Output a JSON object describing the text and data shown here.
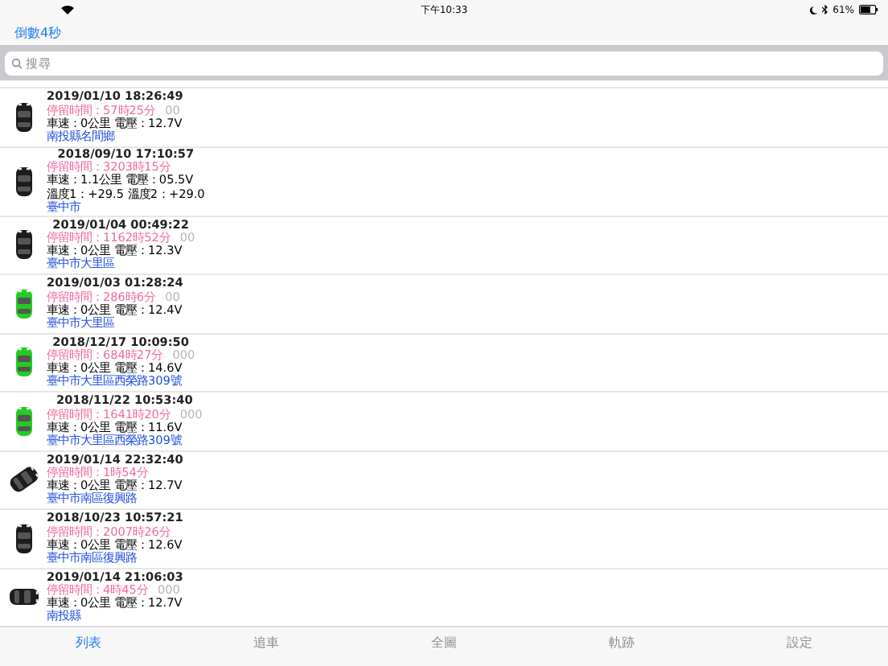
{
  "status_bar": {
    "time": "下午10:33",
    "battery": "61%"
  },
  "nav": {
    "countdown": "倒數4秒"
  },
  "search": {
    "placeholder": "搜尋"
  },
  "rows": [
    {
      "time": "2019/01/10 18:26:49",
      "stay": "停留時間：57時25分",
      "code": "00",
      "stats": "車速：0公里 電壓：12.7V",
      "address": "南投縣名間鄉",
      "kind": "upright",
      "color": "#1c1c1c"
    },
    {
      "time": "2018/09/10 17:10:57",
      "stay": "停留時間：3203時15分",
      "stats": "車速：1.1公里 電壓：05.5V",
      "temps": "溫度1：+29.5 溫度2：+29.0",
      "address": "臺中市",
      "kind": "upright",
      "color": "#1c1c1c"
    },
    {
      "time": "2019/01/04 00:49:22",
      "stay": "停留時間：1162時52分",
      "code": "00",
      "stats": "車速：0公里 電壓：12.3V",
      "address": "臺中市大里區",
      "kind": "upright",
      "color": "#1c1c1c"
    },
    {
      "time": "2019/01/03 01:28:24",
      "stay": "停留時間：286時6分",
      "code": "00",
      "stats": "車速：0公里 電壓：12.4V",
      "address": "臺中市大里區",
      "kind": "upright",
      "color": "#22cc22"
    },
    {
      "time": "2018/12/17 10:09:50",
      "stay": "停留時間：684時27分",
      "code": "000",
      "stats": "車速：0公里 電壓：14.6V",
      "address": "臺中市大里區西榮路309號",
      "kind": "upright",
      "color": "#22cc22"
    },
    {
      "time": "2018/11/22 10:53:40",
      "stay": "停留時間：1641時20分",
      "code": "000",
      "stats": "車速：0公里 電壓：11.6V",
      "address": "臺中市大里區西榮路309號",
      "kind": "upright",
      "color": "#22cc22"
    },
    {
      "time": "2019/01/14 22:32:40",
      "stay": "停留時間：1時54分",
      "stats": "車速：0公里 電壓：12.7V",
      "address": "臺中市南區復興路",
      "kind": "tilted",
      "color": "#1c1c1c"
    },
    {
      "time": "2018/10/23 10:57:21",
      "stay": "停留時間：2007時26分",
      "stats": "車速：0公里 電壓：12.6V",
      "address": "臺中市南區復興路",
      "kind": "upright",
      "color": "#1c1c1c"
    },
    {
      "time": "2019/01/14 21:06:03",
      "stay": "停留時間：4時45分",
      "code": "000",
      "stats": "車速：0公里 電壓：12.7V",
      "address": "南投縣",
      "kind": "side",
      "color": "#1c1c1c"
    }
  ],
  "tabs": [
    {
      "label": "列表",
      "selected": true
    },
    {
      "label": "追車",
      "selected": false
    },
    {
      "label": "全圖",
      "selected": false
    },
    {
      "label": "軌跡",
      "selected": false
    },
    {
      "label": "設定",
      "selected": false
    }
  ]
}
